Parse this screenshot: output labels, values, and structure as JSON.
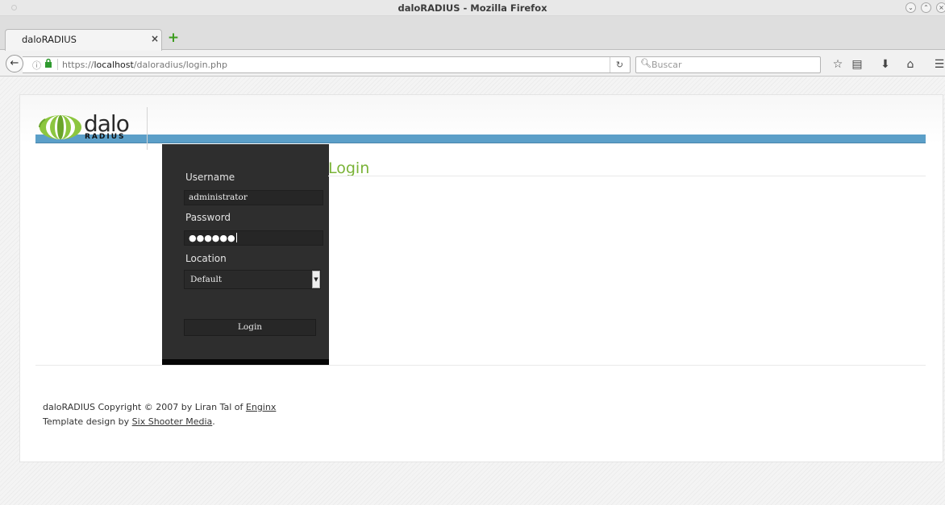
{
  "window": {
    "title": "daloRADIUS - Mozilla Firefox"
  },
  "tab": {
    "title": "daloRADIUS",
    "close_glyph": "×",
    "new_tab_glyph": "+"
  },
  "navbar": {
    "url_prefix": "https://",
    "url_host": "localhost",
    "url_path": "/daloradius/login.php",
    "search_placeholder": "Buscar"
  },
  "logo": {
    "word": "dalo",
    "sub": "RADIUS"
  },
  "login_form": {
    "username_label": "Username",
    "username_value": "administrator",
    "password_label": "Password",
    "password_mask": "●●●●●●",
    "location_label": "Location",
    "location_selected": "Default",
    "login_button": "Login"
  },
  "main": {
    "title": "Login"
  },
  "footer": {
    "copyright_prefix": "daloRADIUS Copyright © 2007 by Liran Tal of ",
    "copyright_link": "Enginx",
    "template_prefix": "Template design by ",
    "template_link": "Six Shooter Media",
    "template_suffix": "."
  },
  "colors": {
    "accent_green": "#7ab337",
    "header_blue": "#5b9fc8",
    "sidebar_bg": "#2e2e2e"
  },
  "icons": {
    "back": "back-arrow-icon",
    "info": "info-icon",
    "lock": "lock-icon",
    "reload": "reload-icon",
    "search": "search-icon",
    "bookmark": "star-icon",
    "reading_list": "bookmarks-list-icon",
    "download": "download-icon",
    "home": "home-icon",
    "menu": "hamburger-menu-icon"
  }
}
